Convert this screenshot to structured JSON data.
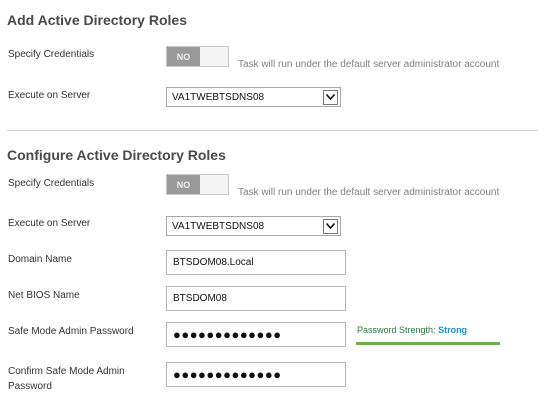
{
  "add_section": {
    "title": "Add Active Directory Roles",
    "specify_credentials_label": "Specify Credentials",
    "toggle_state": "NO",
    "credentials_hint": "Task will run under the default server administrator account",
    "execute_on_server_label": "Execute on Server",
    "server_value": "VA1TWEBTSDNS08"
  },
  "configure_section": {
    "title": "Configure Active Directory Roles",
    "specify_credentials_label": "Specify Credentials",
    "toggle_state": "NO",
    "credentials_hint": "Task will run under the default server administrator account",
    "execute_on_server_label": "Execute on Server",
    "server_value": "VA1TWEBTSDNS08",
    "domain_name_label": "Domain Name",
    "domain_name_value": "BTSDOM08.Local",
    "netbios_label": "Net BIOS Name",
    "netbios_value": "BTSDOM08",
    "safe_mode_password_label": "Safe Mode Admin Password",
    "safe_mode_password_mask": "●●●●●●●●●●●●●",
    "password_strength_label": "Password Strength:",
    "password_strength_value": "Strong",
    "confirm_password_label_line1": "Confirm Safe Mode Admin",
    "confirm_password_label_line2": "Password",
    "confirm_password_mask": "●●●●●●●●●●●●●"
  },
  "colors": {
    "toggle_off": "#9a9a9a",
    "strength_text": "#2b7d3b",
    "strength_value": "#1e8fc7",
    "strength_bar": "#6ab04c"
  },
  "icons": [
    "chevron-down-icon"
  ]
}
